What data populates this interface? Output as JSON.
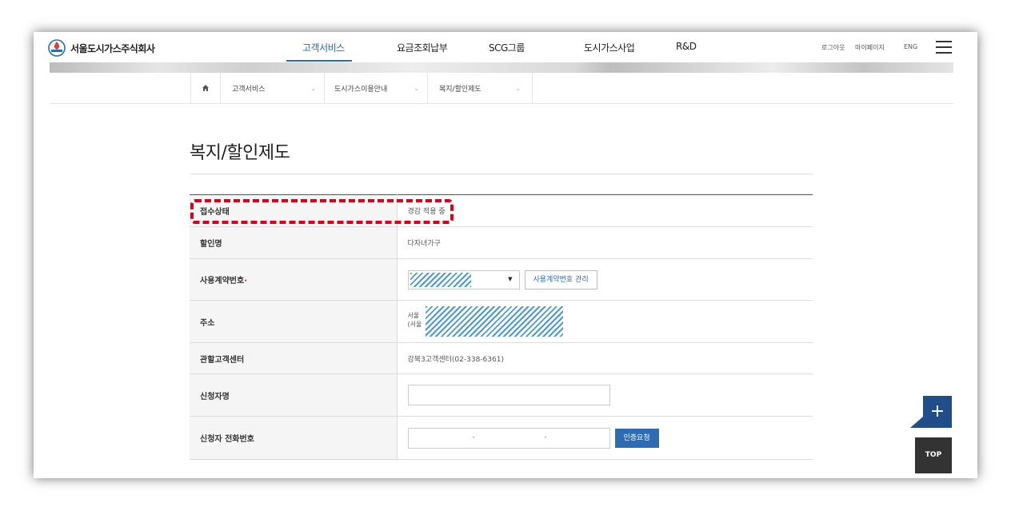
{
  "header": {
    "logo_text": "서울도시가스주식회사",
    "menu": [
      {
        "label": "고객서비스"
      },
      {
        "label": "요금조회납부"
      },
      {
        "label": "SCG그룹"
      },
      {
        "label": "도시가스사업"
      },
      {
        "label": "R&D"
      }
    ],
    "util": [
      "로그아웃",
      "마이페이지",
      "ENG"
    ],
    "brand_color": "#2b6cb3"
  },
  "breadcrumb": {
    "items": [
      {
        "label": "고객서비스"
      },
      {
        "label": "도시가스이용안내"
      },
      {
        "label": "복지/할인제도"
      }
    ]
  },
  "page_title": "복지/할인제도",
  "form": {
    "rows": [
      {
        "label": "접수상태",
        "value": "경감 적용 중"
      },
      {
        "label": "할인명",
        "value": "다자녀가구"
      },
      {
        "label": "사용계약번호",
        "required_mark": "·",
        "manage_button": "사용계약번호 관리"
      },
      {
        "label": "주소",
        "line1": "서울",
        "line2": "(서울"
      },
      {
        "label": "관할고객센터",
        "value": "강북3고객센터(02-338-6361)"
      },
      {
        "label": "신청자명"
      },
      {
        "label": "신청자 전화번호",
        "phone_separator": "-",
        "verify_button": "인증요청"
      }
    ]
  },
  "floating": {
    "plus": "+",
    "top": "TOP"
  },
  "highlight_color": "#d9001b"
}
